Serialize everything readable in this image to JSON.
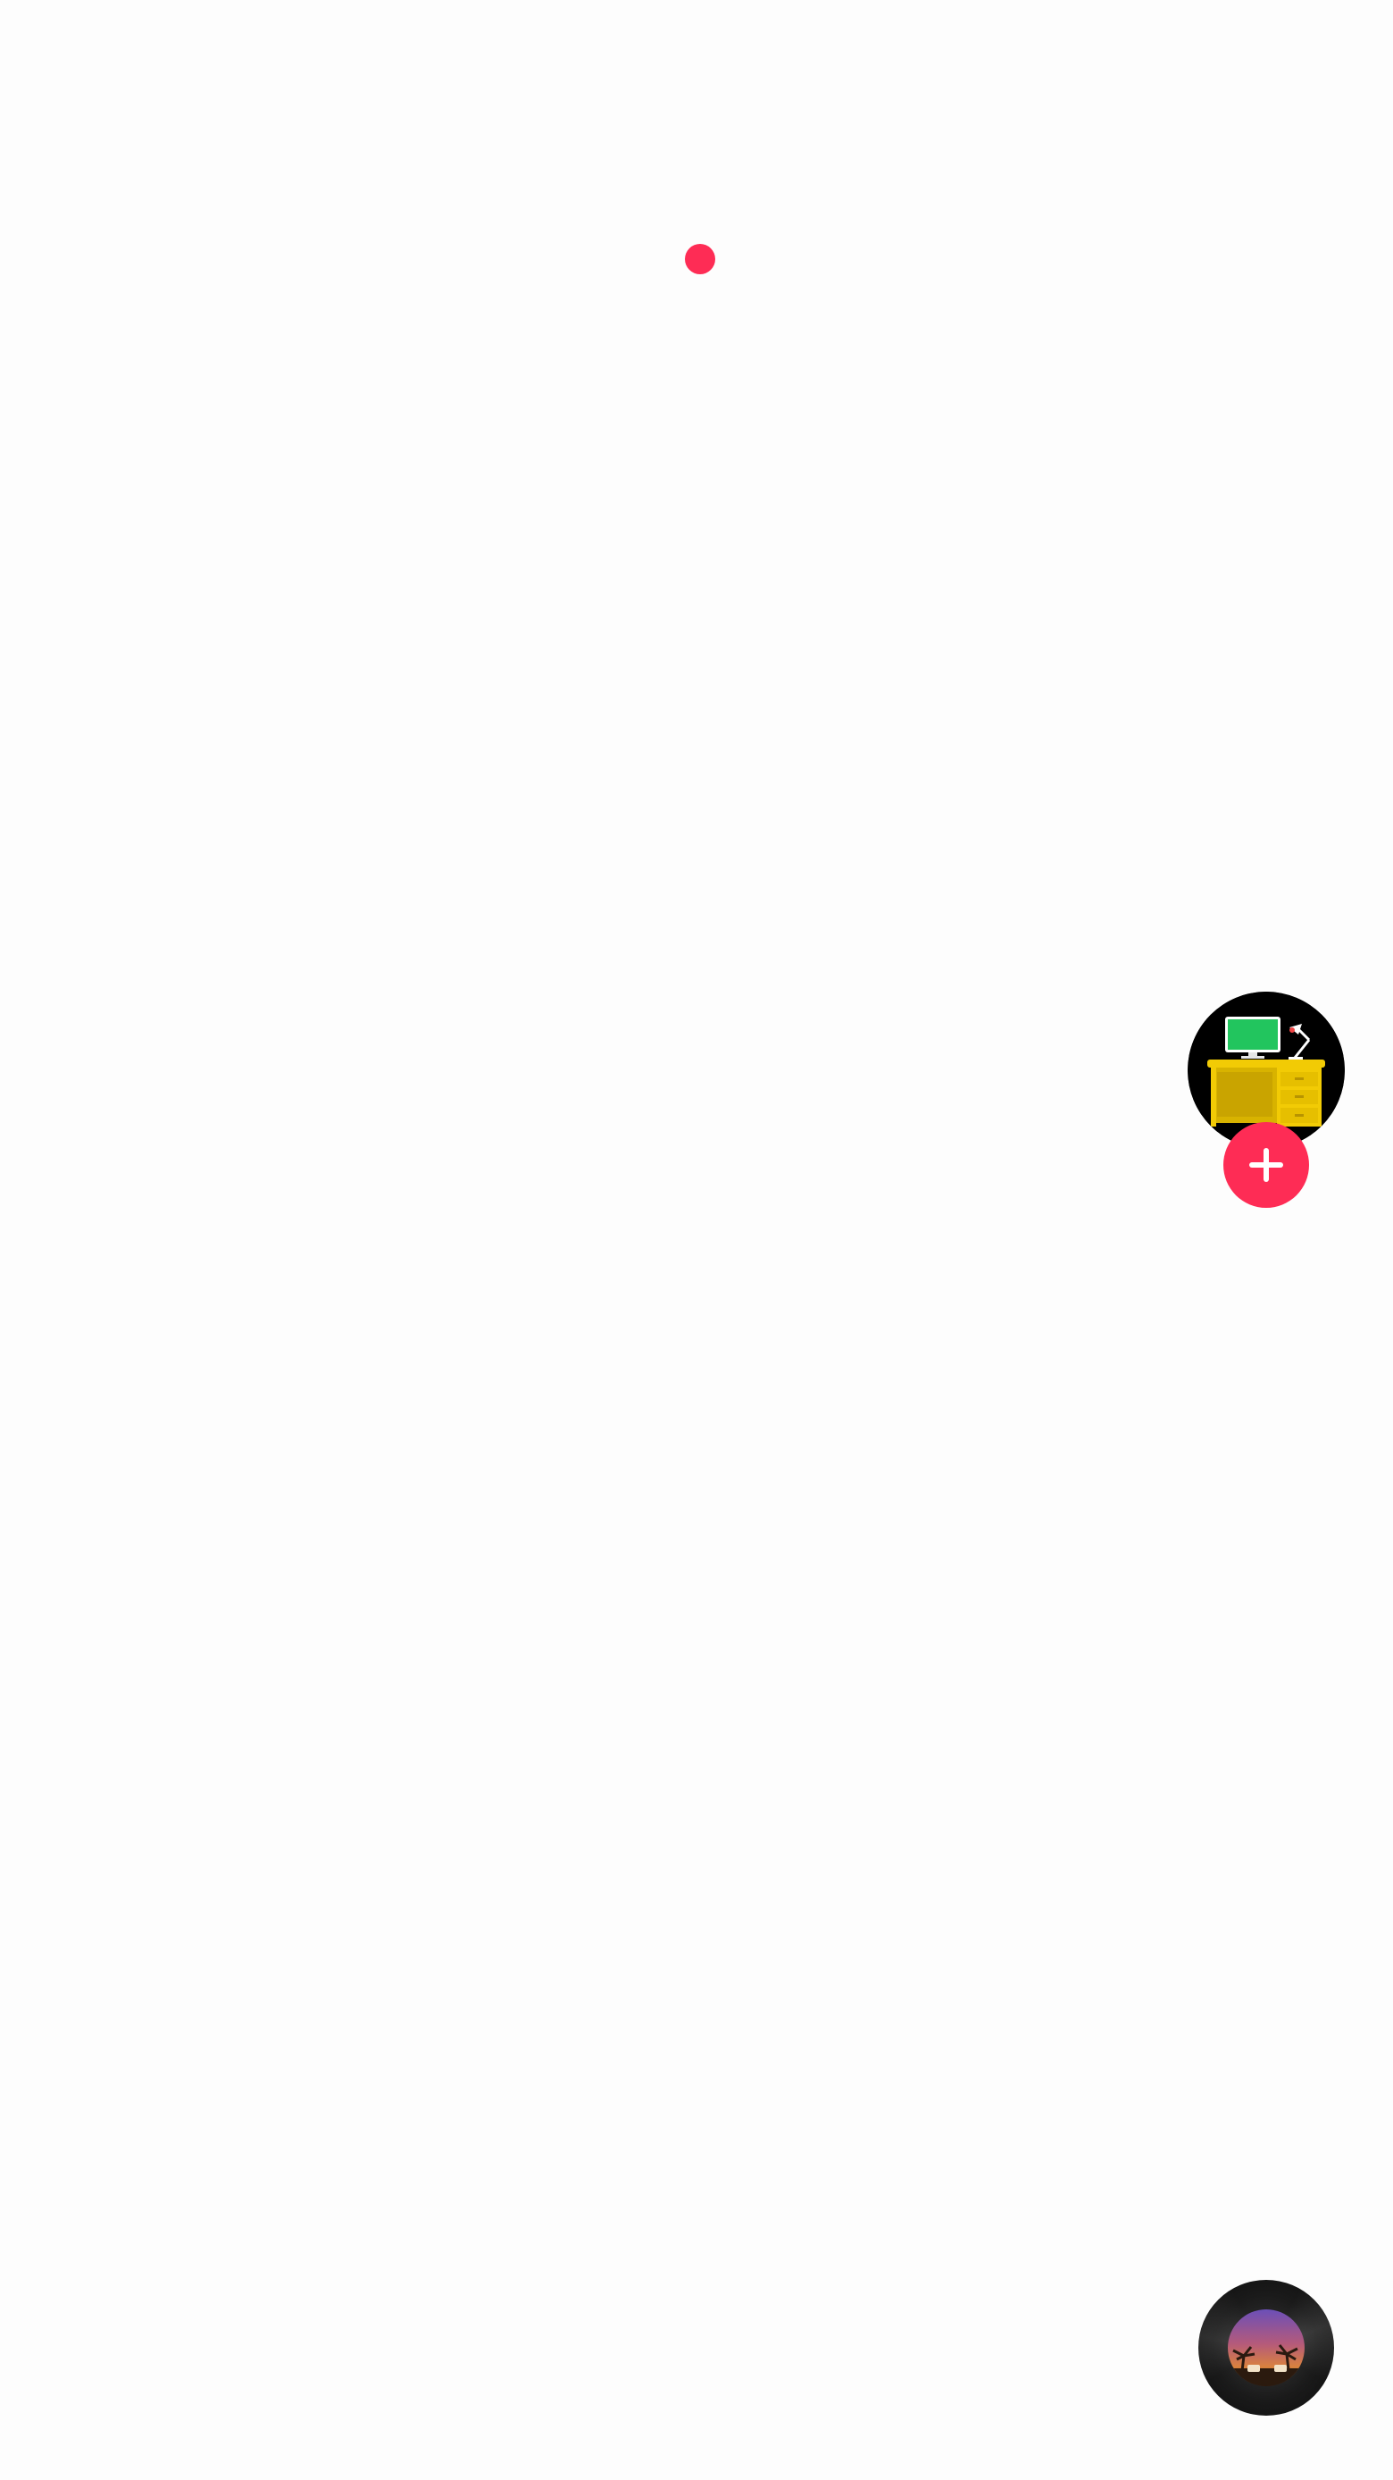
{
  "loading_indicator": {
    "color": "#fe2c55"
  },
  "creator_avatar": {
    "icon": "desk-computer-icon",
    "background": "#000000",
    "desk_color": "#f2cb05",
    "screen_color": "#22c55e"
  },
  "follow_button": {
    "icon": "plus-icon",
    "color": "#fe2c55"
  },
  "music_disc": {
    "icon": "music-disc-icon",
    "cover_image": "album-cover-sunset-palms"
  }
}
